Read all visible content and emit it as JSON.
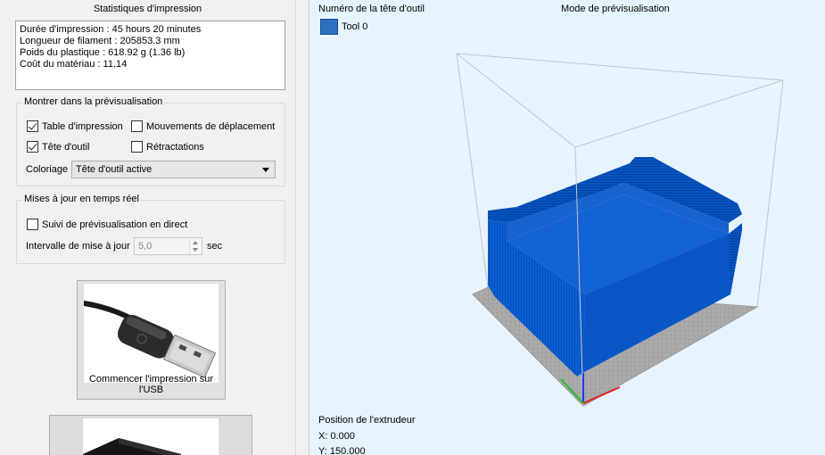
{
  "stats": {
    "title": "Statistiques d'impression",
    "lines": [
      "Durée d'impression : 45 hours 20 minutes",
      "Longueur de filament : 205853.3 mm",
      "Poids du plastique : 618.92 g (1.36 lb)",
      "Coût du matériau : 11.14"
    ]
  },
  "preview": {
    "legend": "Montrer dans la prévisualisation",
    "options": [
      {
        "label": "Table d'impression",
        "checked": true
      },
      {
        "label": "Mouvements de déplacement",
        "checked": false
      },
      {
        "label": "Tête d'outil",
        "checked": true
      },
      {
        "label": "Rétractations",
        "checked": false
      }
    ],
    "coloring_label": "Coloriage",
    "coloring_value": "Tête d'outil active"
  },
  "realtime": {
    "legend": "Mises à jour en temps réel",
    "live_label": "Suivi de prévisualisation en direct",
    "live_checked": false,
    "interval_label": "Intervalle de mise à jour",
    "interval_value": "5,0",
    "interval_unit": "sec"
  },
  "actions": {
    "usb_label": "Commencer l'impression sur l'USB"
  },
  "viewport": {
    "tool_header": "Numéro de la tête d'outil",
    "mode_title": "Mode de prévisualisation",
    "tool_name": "Tool 0",
    "position_label": "Position de l'extrudeur",
    "x_readout": "X: 0.000",
    "y_readout": "Y: 150.000"
  },
  "colors": {
    "model": "#0a5fd6",
    "tool0": "#2c6fc0",
    "background": "#e6f4ff",
    "bed": "#a9a9a9"
  }
}
